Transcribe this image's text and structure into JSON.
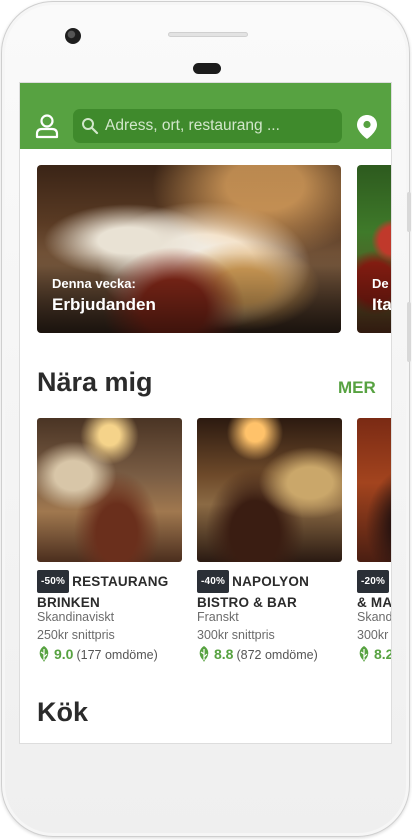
{
  "search": {
    "placeholder": "Adress, ort, restaurang ..."
  },
  "colors": {
    "brand_green": "#57a241",
    "badge_dark": "#2a2f36"
  },
  "icons": {
    "user": "user-icon",
    "search": "search-icon",
    "location": "location-pin-icon",
    "rating": "leaf-rating-icon"
  },
  "promos": [
    {
      "subtitle": "Denna vecka:",
      "title": "Erbjudanden"
    },
    {
      "subtitle": "De",
      "title": "Ita"
    }
  ],
  "nearby": {
    "title": "Nära mig",
    "more_label": "MER",
    "restaurants": [
      {
        "discount": "-50%",
        "name": "RESTAURANG BRINKEN",
        "cuisine": "Skandinaviskt",
        "price": "250kr snittpris",
        "rating": "9.0",
        "reviews": "(177 omdöme)"
      },
      {
        "discount": "-40%",
        "name": "NAPOLYON BISTRO & BAR",
        "cuisine": "Franskt",
        "price": "300kr snittpris",
        "rating": "8.8",
        "reviews": "(872 omdöme)"
      },
      {
        "discount": "-20%",
        "name": "& MA",
        "cuisine": "Skand",
        "price": "300kr",
        "rating": "8.2",
        "reviews": ""
      }
    ]
  },
  "kitchen": {
    "title": "Kök"
  }
}
